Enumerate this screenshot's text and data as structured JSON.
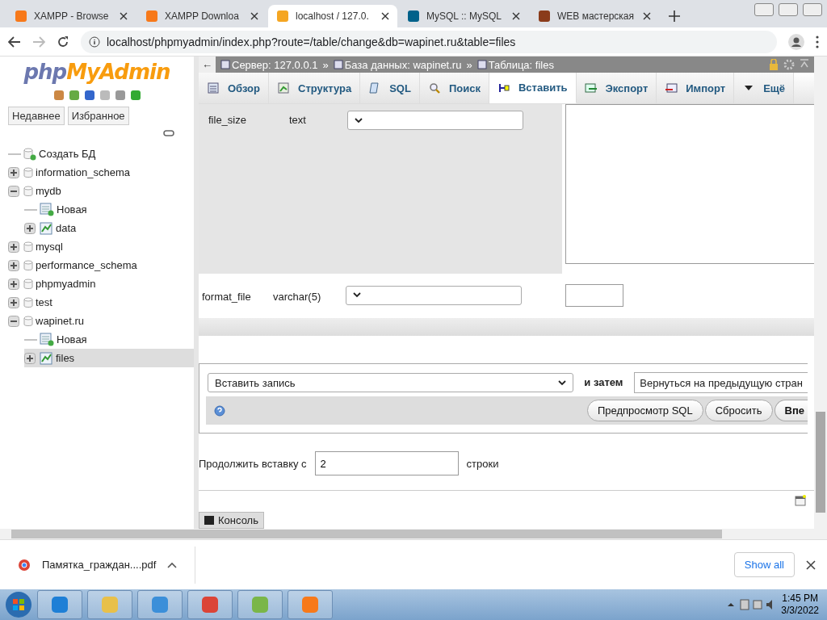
{
  "browser": {
    "tabs": [
      {
        "title": "XAMPP - Browse",
        "selected": false
      },
      {
        "title": "XAMPP Downloa",
        "selected": false
      },
      {
        "title": "localhost / 127.0.",
        "selected": true
      },
      {
        "title": "MySQL :: MySQL",
        "selected": false
      },
      {
        "title": "WEB мастерская",
        "selected": false
      }
    ],
    "address": "localhost/phpmyadmin/index.php?route=/table/change&db=wapinet.ru&table=files"
  },
  "sidebar": {
    "logo": {
      "part_1": "php",
      "part_2": "MyAdmin"
    },
    "buttons": [
      "Недавнее",
      "Избранное"
    ],
    "tree": [
      {
        "label": "Создать БД",
        "kind": "create",
        "selected": false
      },
      {
        "label": "information_schema",
        "kind": "db",
        "expanded": false,
        "selected": false
      },
      {
        "label": "mydb",
        "kind": "db",
        "expanded": true,
        "selected": false,
        "children": [
          {
            "label": "Новая",
            "kind": "new",
            "selected": false
          },
          {
            "label": "data",
            "kind": "table",
            "expanded": false,
            "selected": false
          }
        ]
      },
      {
        "label": "mysql",
        "kind": "db",
        "expanded": false,
        "selected": false
      },
      {
        "label": "performance_schema",
        "kind": "db",
        "expanded": false,
        "selected": false
      },
      {
        "label": "phpmyadmin",
        "kind": "db",
        "expanded": false,
        "selected": false
      },
      {
        "label": "test",
        "kind": "db",
        "expanded": false,
        "selected": false
      },
      {
        "label": "wapinet.ru",
        "kind": "db",
        "expanded": true,
        "selected": false,
        "children": [
          {
            "label": "Новая",
            "kind": "new",
            "selected": false
          },
          {
            "label": "files",
            "kind": "table",
            "expanded": false,
            "selected": true
          }
        ]
      }
    ]
  },
  "breadcrumb": {
    "back": "←",
    "items": [
      {
        "label": "Сервер: 127.0.0.1"
      },
      {
        "separator": "»",
        "label": "База данных: wapinet.ru"
      },
      {
        "separator": "»",
        "label": "Таблица: files"
      }
    ]
  },
  "tabs": [
    {
      "label": "Обзор",
      "selected": false
    },
    {
      "label": "Структура",
      "selected": false
    },
    {
      "label": "SQL",
      "selected": false
    },
    {
      "label": "Поиск",
      "selected": false
    },
    {
      "label": "Вставить",
      "selected": true
    },
    {
      "label": "Экспорт",
      "selected": false
    },
    {
      "label": "Импорт",
      "selected": false
    },
    {
      "label": "Ещё",
      "selected": false
    }
  ],
  "fields": [
    {
      "name": "file_size",
      "type": "text",
      "kind": "textarea"
    },
    {
      "name": "format_file",
      "type": "varchar(5)",
      "kind": "input"
    }
  ],
  "action": {
    "select": "Вставить запись",
    "and_then": "и затем",
    "after": "Вернуться на предыдущую стран",
    "buttons": [
      "Предпросмотр SQL",
      "Сбросить",
      "Впе"
    ]
  },
  "continue": {
    "label": "Продолжить вставку с",
    "value": "2",
    "suffix": "строки"
  },
  "console": "Консоль",
  "download": {
    "file": "Памятка_граждан....pdf",
    "button": "Show all"
  },
  "taskbar": {
    "time": "1:45 PM",
    "date": "3/3/2022"
  }
}
